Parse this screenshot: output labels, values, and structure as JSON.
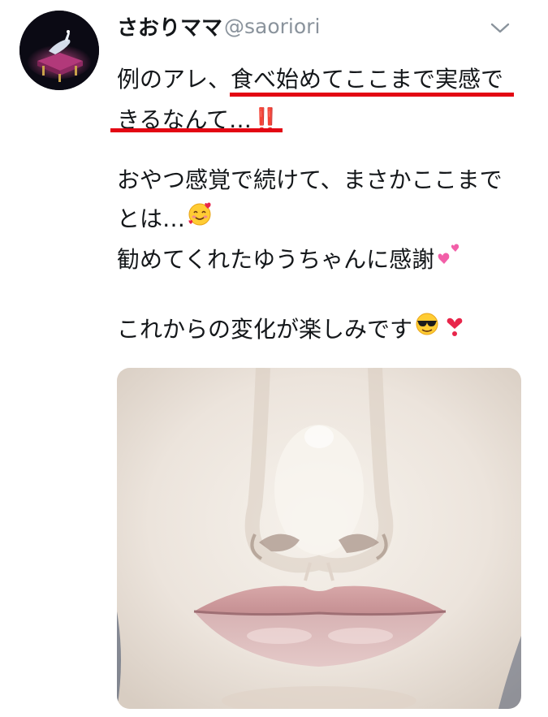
{
  "tweet": {
    "display_name": "さおりママ",
    "handle": "@saoriori",
    "menu_icon": "chevron-down-icon",
    "avatar_icon": "glass-slipper-avatar",
    "text": {
      "line1_plain": "例のアレ、",
      "line1_underlined": "食べ始めてここまで実感で",
      "line2_underlined": "きるなんて…",
      "line2_emoji": "‼️",
      "line3": "おやつ感覚で続けて、まさかここまで",
      "line4": "とは…",
      "line4_emoji": "smiling-face-with-hearts",
      "line5": "勧めてくれたゆうちゃんに感謝",
      "line5_emoji": "two-hearts",
      "line6": "これからの変化が楽しみです",
      "line6_emoji1": "sunglasses-face",
      "line6_emoji2": "heart-exclamation"
    },
    "photo": {
      "subject": "close-up face photo (nose and lips)"
    }
  },
  "colors": {
    "underline": "#e30613",
    "handle": "#8a939c",
    "text": "#14171a"
  }
}
